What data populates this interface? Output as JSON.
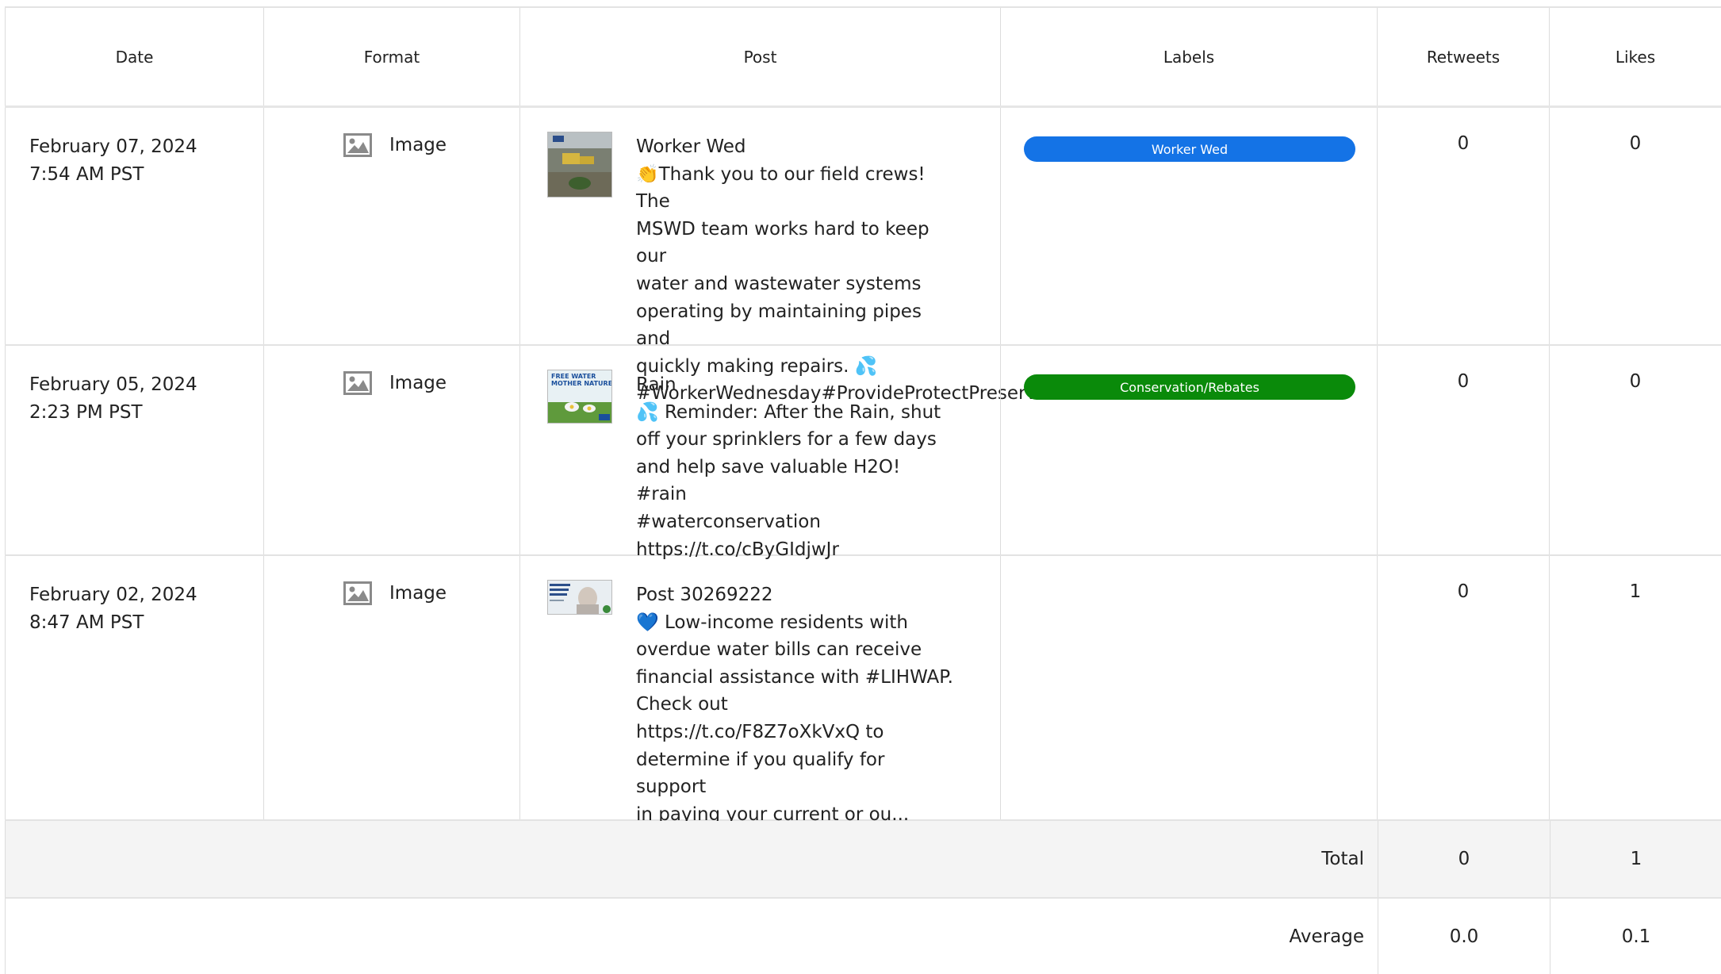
{
  "headers": {
    "date": "Date",
    "format": "Format",
    "post": "Post",
    "labels": "Labels",
    "retweets": "Retweets",
    "likes": "Likes"
  },
  "rows": [
    {
      "date": "February 07, 2024",
      "time": "7:54 AM PST",
      "format": "Image",
      "format_icon": "image-icon",
      "post_title": "Worker Wed",
      "post_body": "👏Thank you to our field crews! The\nMSWD team works hard to keep our\nwater and wastewater systems\noperating by maintaining pipes and\nquickly making repairs. 💦\n#WorkerWednesday#ProvideProtectPreserve...",
      "label": "Worker Wed",
      "label_color": "#1473e6",
      "retweets": "0",
      "likes": "0"
    },
    {
      "date": "February 05, 2024",
      "time": "2:23 PM PST",
      "format": "Image",
      "format_icon": "image-icon",
      "post_title": "Rain",
      "post_body": "💦 Reminder: After the Rain, shut\noff your sprinklers for a few days\nand help save valuable H2O! #rain\n#waterconservation\nhttps://t.co/cByGIdjwJr",
      "label": "Conservation/Rebates",
      "label_color": "#0a8a0a",
      "thumb_text": "FREE WATER FROM MOTHER NATURE",
      "retweets": "0",
      "likes": "0"
    },
    {
      "date": "February 02, 2024",
      "time": "8:47 AM PST",
      "format": "Image",
      "format_icon": "image-icon",
      "post_title": "Post 30269222",
      "post_body": "💙 Low-income residents with\noverdue water bills can receive\nfinancial assistance with #LIHWAP.\nCheck out\nhttps://t.co/F8Z7oXkVxQ to\ndetermine if you qualify for support\nin paying your current or ou...",
      "label": "",
      "retweets": "0",
      "likes": "1"
    }
  ],
  "summary": {
    "total_label": "Total",
    "total_retweets": "0",
    "total_likes": "1",
    "average_label": "Average",
    "average_retweets": "0.0",
    "average_likes": "0.1"
  }
}
